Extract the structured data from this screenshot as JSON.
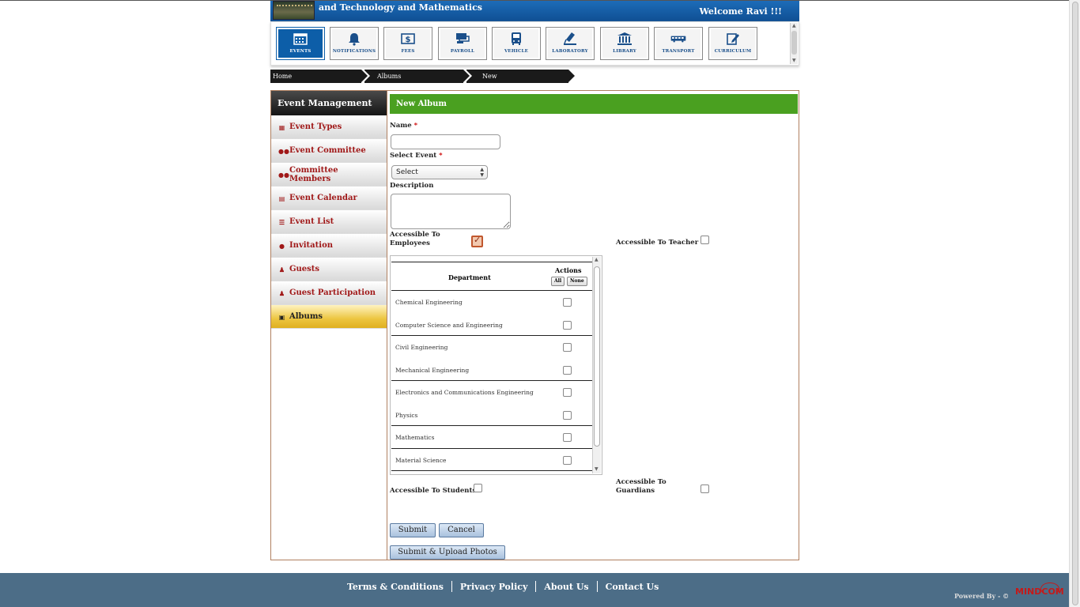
{
  "header": {
    "title": "and Technology and Mathematics",
    "welcome": "Welcome Ravi !!!"
  },
  "modules": [
    {
      "label": "EVENTS",
      "icon": "calendar-icon",
      "active": true
    },
    {
      "label": "NOTIFICATIONS",
      "icon": "bell-icon"
    },
    {
      "label": "FEES",
      "icon": "dollar-bill-icon"
    },
    {
      "label": "PAYROLL",
      "icon": "payroll-icon"
    },
    {
      "label": "VEHICLE",
      "icon": "bus-front-icon"
    },
    {
      "label": "LABORATORY",
      "icon": "flask-icon"
    },
    {
      "label": "LIBRARY",
      "icon": "library-building-icon"
    },
    {
      "label": "TRANSPORT",
      "icon": "bus-side-icon"
    },
    {
      "label": "CURRICULUM",
      "icon": "edit-document-icon"
    }
  ],
  "breadcrumb": [
    "Home",
    "Albums",
    "New"
  ],
  "sidebar": {
    "title": "Event Management",
    "items": [
      {
        "label": "Event Types",
        "icon": "grid-icon"
      },
      {
        "label": "Event Committee",
        "icon": "group-icon"
      },
      {
        "label": "Committee Members",
        "icon": "group-icon"
      },
      {
        "label": "Event Calendar",
        "icon": "calendar-icon"
      },
      {
        "label": "Event List",
        "icon": "list-icon"
      },
      {
        "label": "Invitation",
        "icon": "comment-icon"
      },
      {
        "label": "Guests",
        "icon": "user-icon"
      },
      {
        "label": "Guest Participation",
        "icon": "user-icon"
      },
      {
        "label": "Albums",
        "icon": "picture-icon",
        "active": true
      }
    ]
  },
  "form": {
    "heading": "New Album",
    "name_label": "Name",
    "required_mark": "*",
    "name_value": "",
    "event_label": "Select Event",
    "event_value": "Select",
    "description_label": "Description",
    "description_value": "",
    "employees_label_1": "Accessible To",
    "employees_label_2": "Employees",
    "employees_checked": true,
    "teacher_label": "Accessible To Teacher",
    "students_label": "Accessible To Students",
    "guardians_label_1": "Accessible To",
    "guardians_label_2": "Guardians",
    "submit": "Submit",
    "cancel": "Cancel",
    "submit_upload": "Submit & Upload Photos"
  },
  "department_table": {
    "col_department": "Department",
    "col_actions": "Actions",
    "all": "All",
    "none": "None",
    "rows": [
      "Chemical Engineering",
      "Computer Science and Engineering",
      "Civil Engineering",
      "Mechanical Engineering",
      "Electronics and Communications Engineering",
      "Physics",
      "Mathematics",
      "Material Science"
    ]
  },
  "footer": {
    "links": [
      "Terms & Conditions",
      "Privacy Policy",
      "About Us",
      "Contact Us"
    ],
    "powered": "Powered By - ©",
    "brand": "MINDCOM"
  },
  "colors": {
    "header_blue": "#0f4f93",
    "green_bar": "#4aa020",
    "sidebar_text": "#a01818",
    "active_gold": "#ecc540",
    "footer": "#4c6d87"
  }
}
